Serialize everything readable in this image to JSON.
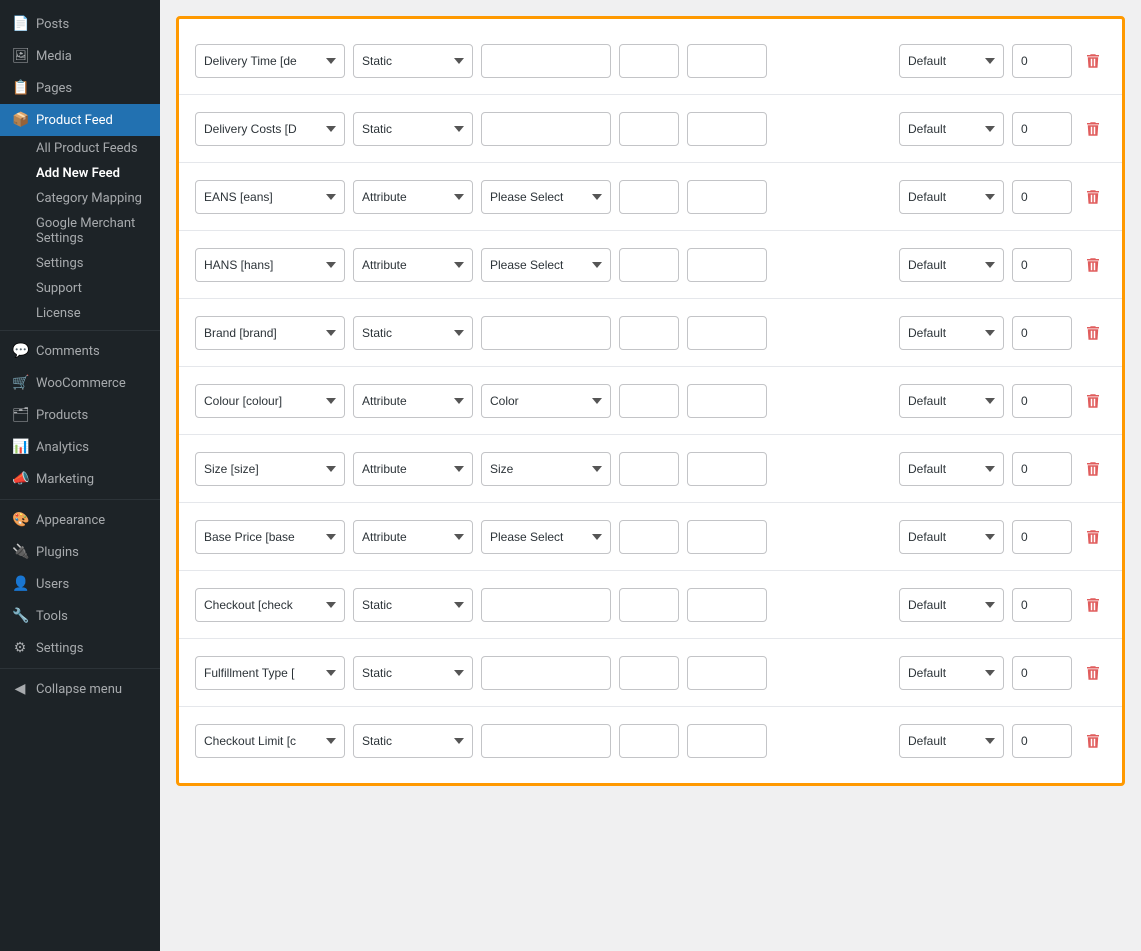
{
  "sidebar": {
    "items": [
      {
        "id": "posts",
        "label": "Posts",
        "icon": "📄"
      },
      {
        "id": "media",
        "label": "Media",
        "icon": "🖼"
      },
      {
        "id": "pages",
        "label": "Pages",
        "icon": "📋"
      },
      {
        "id": "product-feed",
        "label": "Product Feed",
        "icon": "📦",
        "active": true
      },
      {
        "id": "comments",
        "label": "Comments",
        "icon": "💬"
      },
      {
        "id": "woocommerce",
        "label": "WooCommerce",
        "icon": "🛒"
      },
      {
        "id": "products",
        "label": "Products",
        "icon": "🗂"
      },
      {
        "id": "analytics",
        "label": "Analytics",
        "icon": "📊"
      },
      {
        "id": "marketing",
        "label": "Marketing",
        "icon": "📣"
      },
      {
        "id": "appearance",
        "label": "Appearance",
        "icon": "🎨"
      },
      {
        "id": "plugins",
        "label": "Plugins",
        "icon": "🔌"
      },
      {
        "id": "users",
        "label": "Users",
        "icon": "👤"
      },
      {
        "id": "tools",
        "label": "Tools",
        "icon": "🔧"
      },
      {
        "id": "settings",
        "label": "Settings",
        "icon": "⚙"
      },
      {
        "id": "collapse",
        "label": "Collapse menu",
        "icon": "◀"
      }
    ],
    "submenu": [
      {
        "id": "all-product-feeds",
        "label": "All Product Feeds"
      },
      {
        "id": "add-new-feed",
        "label": "Add New Feed",
        "active": true
      },
      {
        "id": "category-mapping",
        "label": "Category Mapping"
      },
      {
        "id": "google-merchant",
        "label": "Google Merchant Settings"
      },
      {
        "id": "sub-settings",
        "label": "Settings"
      },
      {
        "id": "support",
        "label": "Support"
      },
      {
        "id": "license",
        "label": "License"
      }
    ]
  },
  "rows": [
    {
      "id": "delivery-time",
      "field": "Delivery Time [de",
      "type": "Static",
      "attr": "",
      "attr_visible": false,
      "input1": "",
      "input2": "",
      "default": "Default",
      "number": "0"
    },
    {
      "id": "delivery-costs",
      "field": "Delivery Costs [D",
      "type": "Static",
      "attr": "",
      "attr_visible": false,
      "input1": "",
      "input2": "",
      "default": "Default",
      "number": "0"
    },
    {
      "id": "eans",
      "field": "EANS [eans]",
      "type": "Attribute",
      "attr": "Please Select",
      "attr_visible": true,
      "input1": "",
      "input2": "",
      "default": "Default",
      "number": "0"
    },
    {
      "id": "hans",
      "field": "HANS [hans]",
      "type": "Attribute",
      "attr": "Please Select",
      "attr_visible": true,
      "input1": "",
      "input2": "",
      "default": "Default",
      "number": "0"
    },
    {
      "id": "brand",
      "field": "Brand [brand]",
      "type": "Static",
      "attr": "",
      "attr_visible": false,
      "input1": "",
      "input2": "",
      "default": "Default",
      "number": "0"
    },
    {
      "id": "colour",
      "field": "Colour [colour]",
      "type": "Attribute",
      "attr": "Color",
      "attr_visible": true,
      "input1": "",
      "input2": "",
      "default": "Default",
      "number": "0"
    },
    {
      "id": "size",
      "field": "Size [size]",
      "type": "Attribute",
      "attr": "Size",
      "attr_visible": true,
      "input1": "",
      "input2": "",
      "default": "Default",
      "number": "0"
    },
    {
      "id": "base-price",
      "field": "Base Price [base",
      "type": "Attribute",
      "attr": "Please Select",
      "attr_visible": true,
      "input1": "",
      "input2": "",
      "default": "Default",
      "number": "0"
    },
    {
      "id": "checkout",
      "field": "Checkout [check",
      "type": "Static",
      "attr": "",
      "attr_visible": false,
      "input1": "",
      "input2": "",
      "default": "Default",
      "number": "0"
    },
    {
      "id": "fulfillment",
      "field": "Fulfillment Type [",
      "type": "Static",
      "attr": "",
      "attr_visible": false,
      "input1": "",
      "input2": "",
      "default": "Default",
      "number": "0"
    },
    {
      "id": "checkout-limit",
      "field": "Checkout Limit [c",
      "type": "Static",
      "attr": "",
      "attr_visible": false,
      "input1": "",
      "input2": "",
      "default": "Default",
      "number": "0"
    }
  ],
  "labels": {
    "delete_icon": "🗑",
    "dropdown_icon": "▾",
    "default_option": "Default",
    "static_option": "Static",
    "attribute_option": "Attribute",
    "please_select": "Please Select",
    "color_option": "Color",
    "size_option": "Size"
  }
}
